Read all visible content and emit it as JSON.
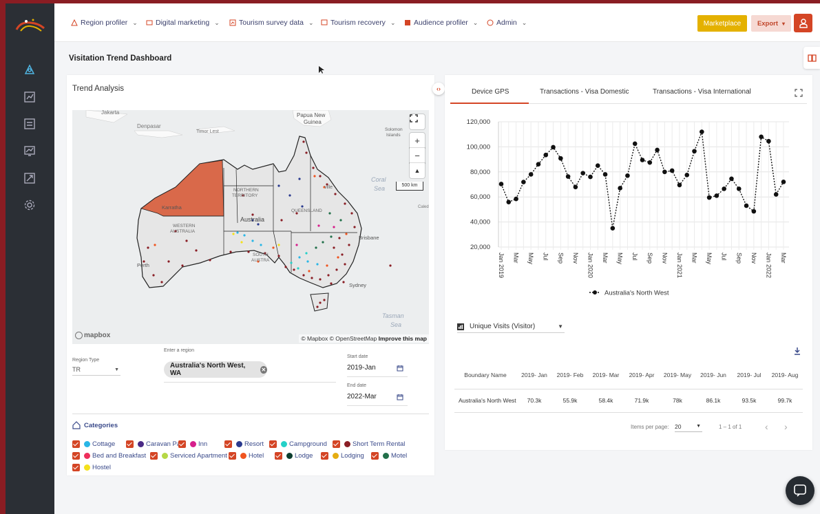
{
  "nav": [
    {
      "label": "Region profiler",
      "icon": "pin-icon"
    },
    {
      "label": "Digital marketing",
      "icon": "image-icon"
    },
    {
      "label": "Tourism survey data",
      "icon": "chart-icon"
    },
    {
      "label": "Tourism recovery",
      "icon": "recovery-icon"
    },
    {
      "label": "Audience profiler",
      "icon": "audience-icon"
    },
    {
      "label": "Admin",
      "icon": "admin-icon"
    }
  ],
  "header": {
    "marketplace_label": "Marketplace",
    "export_label": "Export"
  },
  "page": {
    "title": "Visitation Trend Dashboard"
  },
  "trend": {
    "title": "Trend Analysis",
    "map": {
      "labels": {
        "jakarta": "Jakarta",
        "denpasar": "Denpasar",
        "timor": "Timor Lest",
        "papua": "Papua New",
        "guinea": "Guinea",
        "solomon1": "Solomon",
        "solomon2": "Islands",
        "coral1": "Coral",
        "coral2": "Sea",
        "nt1": "NORTHERN",
        "nt2": "TERRITORY",
        "qld": "QUEENSLAND",
        "wa1": "WESTERN",
        "wa2": "AUSTRALIA",
        "australia": "Australia",
        "sa1": "SOUTH",
        "sa2": "AUSTRA",
        "brisbane": "Brisbane",
        "sydney": "Sydney",
        "perth": "Perth",
        "karratha": "Karratha",
        "tasman1": "Tasman",
        "tasman2": "Sea",
        "townsville": "ville",
        "new_cal": "Caled"
      },
      "scale": "500 km",
      "mapbox": "mapbox",
      "attribution": "© Mapbox © OpenStreetMap",
      "improve": "Improve this map"
    },
    "region_type": {
      "label": "Region Type",
      "value": "TR"
    },
    "region": {
      "label": "Enter a region",
      "chip": "Australia's North West, WA"
    },
    "start": {
      "label": "Start date",
      "value": "2019-Jan"
    },
    "end": {
      "label": "End date",
      "value": "2022-Mar"
    },
    "categories_title": "Categories",
    "categories": [
      {
        "label": "Cottage",
        "color": "#29b6e6"
      },
      {
        "label": "Caravan Park",
        "color": "#4a2a86"
      },
      {
        "label": "Inn",
        "color": "#d61f8c"
      },
      {
        "label": "Resort",
        "color": "#2a3a8e"
      },
      {
        "label": "Campground",
        "color": "#25d1c8"
      },
      {
        "label": "Short Term Rental",
        "color": "#8a1e25"
      },
      {
        "label": "Bed and Breakfast",
        "color": "#ee2f5c"
      },
      {
        "label": "Serviced Apartment",
        "color": "#b6d846"
      },
      {
        "label": "Hotel",
        "color": "#f0541f"
      },
      {
        "label": "Lodge",
        "color": "#0c3d2e"
      },
      {
        "label": "Lodging",
        "color": "#e5ad12"
      },
      {
        "label": "Motel",
        "color": "#22704a"
      },
      {
        "label": "Hostel",
        "color": "#f4e11c"
      }
    ],
    "colors": {
      "accent": "#d44525",
      "highlight_region": "#d9694a"
    }
  },
  "tabs": [
    "Device GPS",
    "Transactions - Visa Domestic",
    "Transactions - Visa International"
  ],
  "chart_data": {
    "type": "line",
    "x": [
      "2019-Jan",
      "2019-Feb",
      "2019-Mar",
      "2019-Apr",
      "2019-May",
      "2019-Jun",
      "2019-Jul",
      "2019-Aug",
      "2019-Sep",
      "2019-Oct",
      "2019-Nov",
      "2019-Dec",
      "2020-Jan",
      "2020-Feb",
      "2020-Mar",
      "2020-Apr",
      "2020-May",
      "2020-Jun",
      "2020-Jul",
      "2020-Aug",
      "2020-Sep",
      "2020-Oct",
      "2020-Nov",
      "2020-Dec",
      "2021-Jan",
      "2021-Feb",
      "2021-Mar",
      "2021-Apr",
      "2021-May",
      "2021-Jun",
      "2021-Jul",
      "2021-Aug",
      "2021-Sep",
      "2021-Oct",
      "2021-Nov",
      "2021-Dec",
      "2022-Jan",
      "2022-Feb",
      "2022-Mar"
    ],
    "tick_labels": [
      "Jan 2019",
      "Mar",
      "May",
      "Jul",
      "Sep",
      "Nov",
      "Jan 2020",
      "Mar",
      "May",
      "Jul",
      "Sep",
      "Nov",
      "Jan 2021",
      "Mar",
      "May",
      "Jul",
      "Sep",
      "Nov",
      "Jan 2022",
      "Mar"
    ],
    "series": [
      {
        "name": "Australia's North West",
        "values": [
          70300,
          55900,
          58400,
          71900,
          78000,
          86100,
          93500,
          99700,
          90800,
          76300,
          67900,
          79000,
          76000,
          85000,
          78000,
          35000,
          67000,
          77000,
          102500,
          89500,
          87500,
          97500,
          80000,
          81000,
          69500,
          77500,
          96500,
          112000,
          59500,
          61000,
          66500,
          74500,
          66500,
          53000,
          48500,
          108000,
          104500,
          62000,
          72000
        ]
      }
    ],
    "ylim": [
      20000,
      120000
    ],
    "yticks": [
      "20,000",
      "40,000",
      "60,000",
      "80,000",
      "100,000",
      "120,000"
    ],
    "legend": "bottom",
    "grid": true
  },
  "metric": {
    "label": "Unique Visits (Visitor)"
  },
  "table": {
    "headers": [
      "Boundary Name",
      "2019- Jan",
      "2019- Feb",
      "2019- Mar",
      "2019- Apr",
      "2019- May",
      "2019- Jun",
      "2019- Jul",
      "2019- Aug"
    ],
    "rows": [
      [
        "Australia's North West",
        "70.3k",
        "55.9k",
        "58.4k",
        "71.9k",
        "78k",
        "86.1k",
        "93.5k",
        "99.7k"
      ]
    ]
  },
  "pager": {
    "items_label": "Items per page:",
    "size": "20",
    "range": "1 – 1 of 1"
  }
}
